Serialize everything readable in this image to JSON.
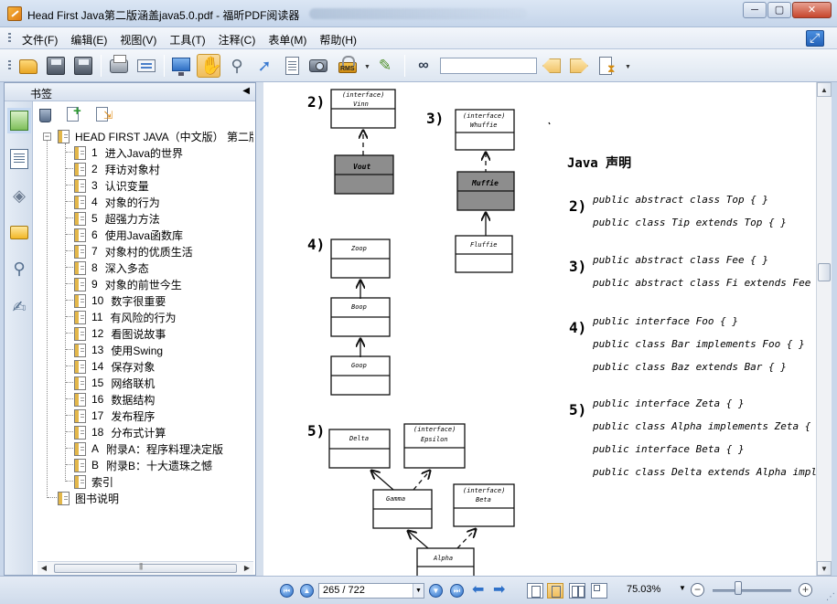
{
  "window": {
    "title": "Head First Java第二版涵盖java5.0.pdf - 福昕PDF阅读器",
    "buttons": {
      "minimize": "─",
      "maximize": "▢",
      "close": "✕"
    }
  },
  "menu": {
    "items": [
      "文件(F)",
      "编辑(E)",
      "视图(V)",
      "工具(T)",
      "注释(C)",
      "表单(M)",
      "帮助(H)"
    ]
  },
  "toolbar": {
    "icons": [
      "open-folder-icon",
      "save-icon",
      "save-as-icon",
      "print-icon",
      "scan-icon",
      "fullscreen-icon",
      "hand-tool-icon",
      "zoom-glass-icon",
      "select-cursor-icon",
      "text-select-icon",
      "snapshot-icon",
      "rms-lock-icon",
      "sign-pen-icon",
      "find-binoculars-icon",
      "find-prev-icon",
      "find-next-icon",
      "sort-icon"
    ],
    "rms_label": "RMS",
    "search_value": ""
  },
  "bookmarks": {
    "header": "书签",
    "collapse": "◀",
    "root": "HEAD FIRST JAVA（中文版） 第二版",
    "chapters": [
      {
        "num": "1",
        "label": "进入Java的世界"
      },
      {
        "num": "2",
        "label": "拜访对象村"
      },
      {
        "num": "3",
        "label": "认识变量"
      },
      {
        "num": "4",
        "label": "对象的行为"
      },
      {
        "num": "5",
        "label": "超强力方法"
      },
      {
        "num": "6",
        "label": "使用Java函数库"
      },
      {
        "num": "7",
        "label": "对象村的优质生活"
      },
      {
        "num": "8",
        "label": "深入多态"
      },
      {
        "num": "9",
        "label": "对象的前世今生"
      },
      {
        "num": "10",
        "label": "数字很重要"
      },
      {
        "num": "11",
        "label": "有风险的行为"
      },
      {
        "num": "12",
        "label": "看图说故事"
      },
      {
        "num": "13",
        "label": "使用Swing"
      },
      {
        "num": "14",
        "label": " 保存对象"
      },
      {
        "num": "15",
        "label": "网络联机"
      },
      {
        "num": "16",
        "label": "数据结构"
      },
      {
        "num": "17",
        "label": "发布程序"
      },
      {
        "num": "18",
        "label": "分布式计算"
      },
      {
        "num": "A",
        "label": "附录A：程序料理决定版"
      },
      {
        "num": "B",
        "label": "附录B：十大遗珠之憾"
      },
      {
        "num": "",
        "label": "索引"
      }
    ],
    "extra": "图书说明"
  },
  "document": {
    "diagram_labels": {
      "n2": "2)",
      "n3": "3)",
      "n4": "4)",
      "n5": "5)",
      "iface": "(interface)",
      "vinn": "Vinn",
      "vout": "Vout",
      "whuffie": "Whuffie",
      "muffie": "Muffie",
      "fluffie": "Fluffie",
      "zoop": "Zoop",
      "boop": "Boop",
      "goop": "Goop",
      "delta": "Delta",
      "epsilon": "Epsilon",
      "gamma": "Gamma",
      "beta": "Beta",
      "alpha": "Alpha"
    },
    "heading": "Java 声明",
    "code_blocks": [
      {
        "num": "2)",
        "lines": [
          "public abstract class Top { }",
          "public class Tip extends Top { }"
        ]
      },
      {
        "num": "3)",
        "lines": [
          "public abstract class Fee { }",
          "public abstract class Fi extends Fee { }"
        ]
      },
      {
        "num": "4)",
        "lines": [
          "public interface Foo { }",
          "public class Bar implements Foo { }",
          "public class Baz extends Bar { }"
        ]
      },
      {
        "num": "5)",
        "lines": [
          "public interface Zeta { }",
          "public class Alpha implements Zeta { }",
          "public interface Beta { }",
          "public class Delta extends Alpha impleme"
        ]
      }
    ]
  },
  "status": {
    "page_value": "265 / 722",
    "zoom": "75.03%"
  },
  "colors": {
    "accent": "#2c6fc7",
    "active_tool": "#f0bd59"
  }
}
